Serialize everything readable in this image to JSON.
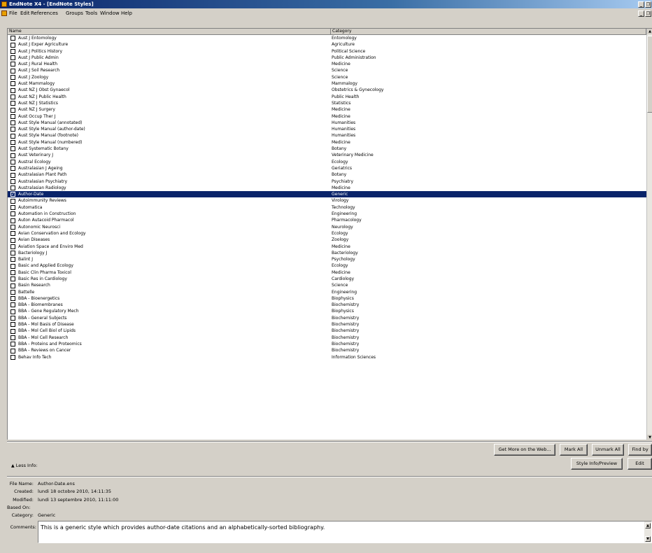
{
  "window": {
    "title": "EndNote X4 - [EndNote Styles]"
  },
  "menu": [
    "File",
    "Edit",
    "References",
    "Groups",
    "Tools",
    "Window",
    "Help"
  ],
  "list": {
    "columns": {
      "name": "Name",
      "category": "Category"
    },
    "rows": [
      {
        "name": "Aust J Entomology",
        "category": "Entomology",
        "checked": false
      },
      {
        "name": "Aust J Exper Agriculture",
        "category": "Agriculture",
        "checked": false
      },
      {
        "name": "Aust J Politics History",
        "category": "Political Science",
        "checked": false
      },
      {
        "name": "Aust J Public Admin",
        "category": "Public Administration",
        "checked": false
      },
      {
        "name": "Aust J Rural Health",
        "category": "Medicine",
        "checked": false
      },
      {
        "name": "Aust J Soil Research",
        "category": "Science",
        "checked": false
      },
      {
        "name": "Aust J Zoology",
        "category": "Science",
        "checked": false
      },
      {
        "name": "Aust Mammalogy",
        "category": "Mammalogy",
        "checked": false
      },
      {
        "name": "Aust NZ J Obst Gynaecol",
        "category": "Obstetrics & Gynecology",
        "checked": false
      },
      {
        "name": "Aust NZ J Public Health",
        "category": "Public Health",
        "checked": false
      },
      {
        "name": "Aust NZ J Statistics",
        "category": "Statistics",
        "checked": false
      },
      {
        "name": "Aust NZ J Surgery",
        "category": "Medicine",
        "checked": false
      },
      {
        "name": "Aust Occup Ther J",
        "category": "Medicine",
        "checked": false
      },
      {
        "name": "Aust Style Manual (annotated)",
        "category": "Humanities",
        "checked": false
      },
      {
        "name": "Aust Style Manual (author-date)",
        "category": "Humanities",
        "checked": false
      },
      {
        "name": "Aust Style Manual (footnote)",
        "category": "Humanities",
        "checked": false
      },
      {
        "name": "Aust Style Manual (numbered)",
        "category": "Medicine",
        "checked": false
      },
      {
        "name": "Aust Systematic Botany",
        "category": "Botany",
        "checked": false
      },
      {
        "name": "Aust Veterinary J",
        "category": "Veterinary Medicine",
        "checked": false
      },
      {
        "name": "Austral Ecology",
        "category": "Ecology",
        "checked": false
      },
      {
        "name": "Australasian J Ageing",
        "category": "Geriatrics",
        "checked": false
      },
      {
        "name": "Australasian Plant Path",
        "category": "Botany",
        "checked": false
      },
      {
        "name": "Australasian Psychiatry",
        "category": "Psychiatry",
        "checked": false
      },
      {
        "name": "Australasian Radiology",
        "category": "Medicine",
        "checked": false
      },
      {
        "name": "Author-Date",
        "category": "Generic",
        "checked": true,
        "selected": true
      },
      {
        "name": "Autoimmunity Reviews",
        "category": "Virology",
        "checked": false
      },
      {
        "name": "Automatica",
        "category": "Technology",
        "checked": false
      },
      {
        "name": "Automation in Construction",
        "category": "Engineering",
        "checked": false
      },
      {
        "name": "Auton Autacoid Pharmacol",
        "category": "Pharmacology",
        "checked": false
      },
      {
        "name": "Autonomic Neurosci",
        "category": "Neurology",
        "checked": false
      },
      {
        "name": "Avian Conservation and Ecology",
        "category": "Ecology",
        "checked": false
      },
      {
        "name": "Avian Diseases",
        "category": "Zoology",
        "checked": false
      },
      {
        "name": "Aviation Space and Enviro Med",
        "category": "Medicine",
        "checked": false
      },
      {
        "name": "Bacteriology J",
        "category": "Bacteriology",
        "checked": false
      },
      {
        "name": "Balint J",
        "category": "Psychology",
        "checked": false
      },
      {
        "name": "Basic and Applied Ecology",
        "category": "Ecology",
        "checked": false
      },
      {
        "name": "Basic Clin Pharma Toxicol",
        "category": "Medicine",
        "checked": false
      },
      {
        "name": "Basic Res in Cardiology",
        "category": "Cardiology",
        "checked": false
      },
      {
        "name": "Basin Research",
        "category": "Science",
        "checked": false
      },
      {
        "name": "Battelle",
        "category": "Engineering",
        "checked": false
      },
      {
        "name": "BBA - Bioenergetics",
        "category": "Biophysics",
        "checked": false
      },
      {
        "name": "BBA - Biomembranes",
        "category": "Biochemistry",
        "checked": false
      },
      {
        "name": "BBA - Gene Regulatory Mech",
        "category": "Biophysics",
        "checked": false
      },
      {
        "name": "BBA - General Subjects",
        "category": "Biochemistry",
        "checked": false
      },
      {
        "name": "BBA - Mol Basis of Disease",
        "category": "Biochemistry",
        "checked": false
      },
      {
        "name": "BBA - Mol Cell Biol of Lipids",
        "category": "Biochemistry",
        "checked": false
      },
      {
        "name": "BBA - Mol Cell Research",
        "category": "Biochemistry",
        "checked": false
      },
      {
        "name": "BBA - Proteins and Proteomics",
        "category": "Biochemistry",
        "checked": false
      },
      {
        "name": "BBA - Reviews on Cancer",
        "category": "Biochemistry",
        "checked": false
      },
      {
        "name": "Behav Info Tech",
        "category": "Information Sciences",
        "checked": false
      }
    ]
  },
  "buttons": {
    "get_more": "Get More on the Web...",
    "mark_all": "Mark All",
    "unmark_all": "Unmark All",
    "find_by": "Find by",
    "style_info": "Style Info/Preview",
    "edit": "Edit"
  },
  "info": {
    "less_info": "Less Info:",
    "file_name_label": "File Name:",
    "file_name": "Author-Date.ens",
    "created_label": "Created:",
    "created": "lundi 18 octobre 2010, 14:11:35",
    "modified_label": "Modified:",
    "modified": "lundi 13 septembre 2010, 11:11:00",
    "based_on_label": "Based On:",
    "based_on": "",
    "category_label": "Category:",
    "category": "Generic",
    "comments_label": "Comments:",
    "comments": "This is a generic style which provides author-date citations and an alphabetically-sorted bibliography."
  }
}
